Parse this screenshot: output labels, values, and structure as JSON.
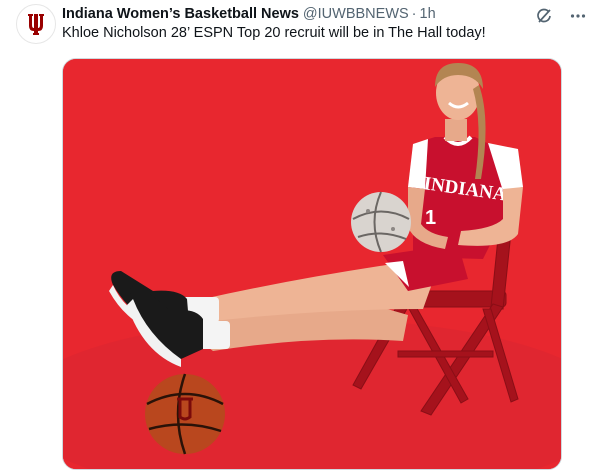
{
  "tweet": {
    "author_name": "Indiana Women’s Basketball News",
    "author_handle": "@IUWBBNEWS",
    "separator": "·",
    "time": "1h",
    "text": "Khloe Nicholson 28’ ESPN Top 20 recruit will be in The Hall today!"
  },
  "media": {
    "jersey_text": "INDIANA",
    "jersey_number": "1",
    "background_color": "#e8272f",
    "jersey_color": "#c8102e"
  },
  "icons": {
    "avatar": "iu-trident-logo",
    "grok": "grok-icon",
    "more": "more-icon"
  }
}
